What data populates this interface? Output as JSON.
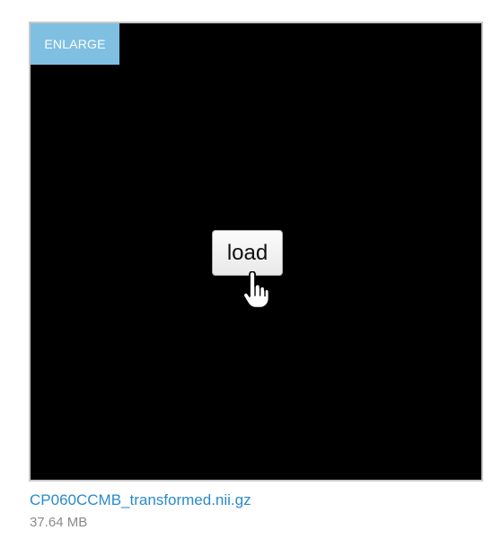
{
  "viewer": {
    "enlarge_label": "ENLARGE",
    "load_label": "load",
    "cursor_icon": "hand-pointer-icon"
  },
  "file": {
    "name": "CP060CCMB_transformed.nii.gz",
    "size": "37.64 MB"
  },
  "colors": {
    "viewer_background": "#000000",
    "enlarge_background": "#7fbfe1",
    "link": "#2b8acb",
    "muted_text": "#8a8a8a"
  }
}
